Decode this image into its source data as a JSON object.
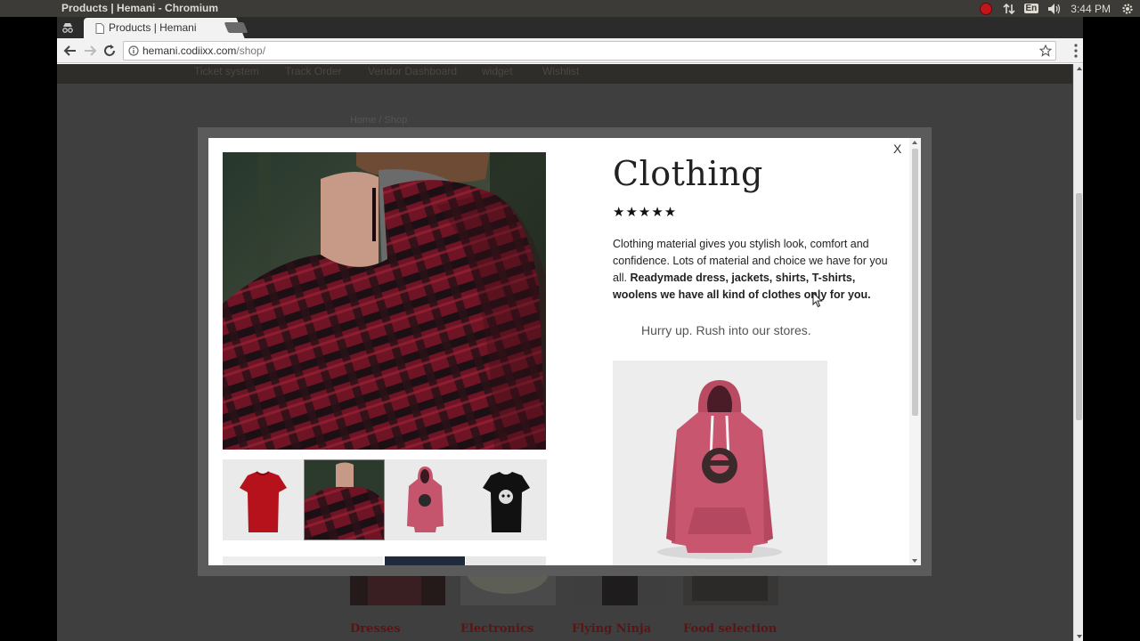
{
  "os": {
    "window_title": "Products | Hemani - Chromium",
    "language": "En",
    "time": "3:44 PM"
  },
  "browser": {
    "tab_title": "Products | Hemani",
    "url_host": "hemani.codiixx.com",
    "url_path": "/shop/"
  },
  "site": {
    "nav": [
      "Ticket system",
      "Track Order",
      "Vendor Dashboard",
      "widget",
      "Wishlist"
    ],
    "breadcrumb": "Home / Shop",
    "categories": [
      "Dresses",
      "Electronics",
      "Flying Ninja",
      "Food selection"
    ]
  },
  "modal": {
    "close_label": "X",
    "title": "Clothing",
    "rating_stars": "★★★★★",
    "rating_value": 5,
    "description_plain": "Clothing material gives you stylish look, comfort and confidence. Lots of material and choice we have for you all.",
    "description_bold": "Readymade dress, jackets, shirts, T-shirts, woolens we have all kind of clothes only for you.",
    "tagline": "Hurry up. Rush into our stores."
  },
  "colors": {
    "accent": "#5b1414",
    "overlay": "#3f3f3f",
    "shirt_red": "#b5121b"
  }
}
